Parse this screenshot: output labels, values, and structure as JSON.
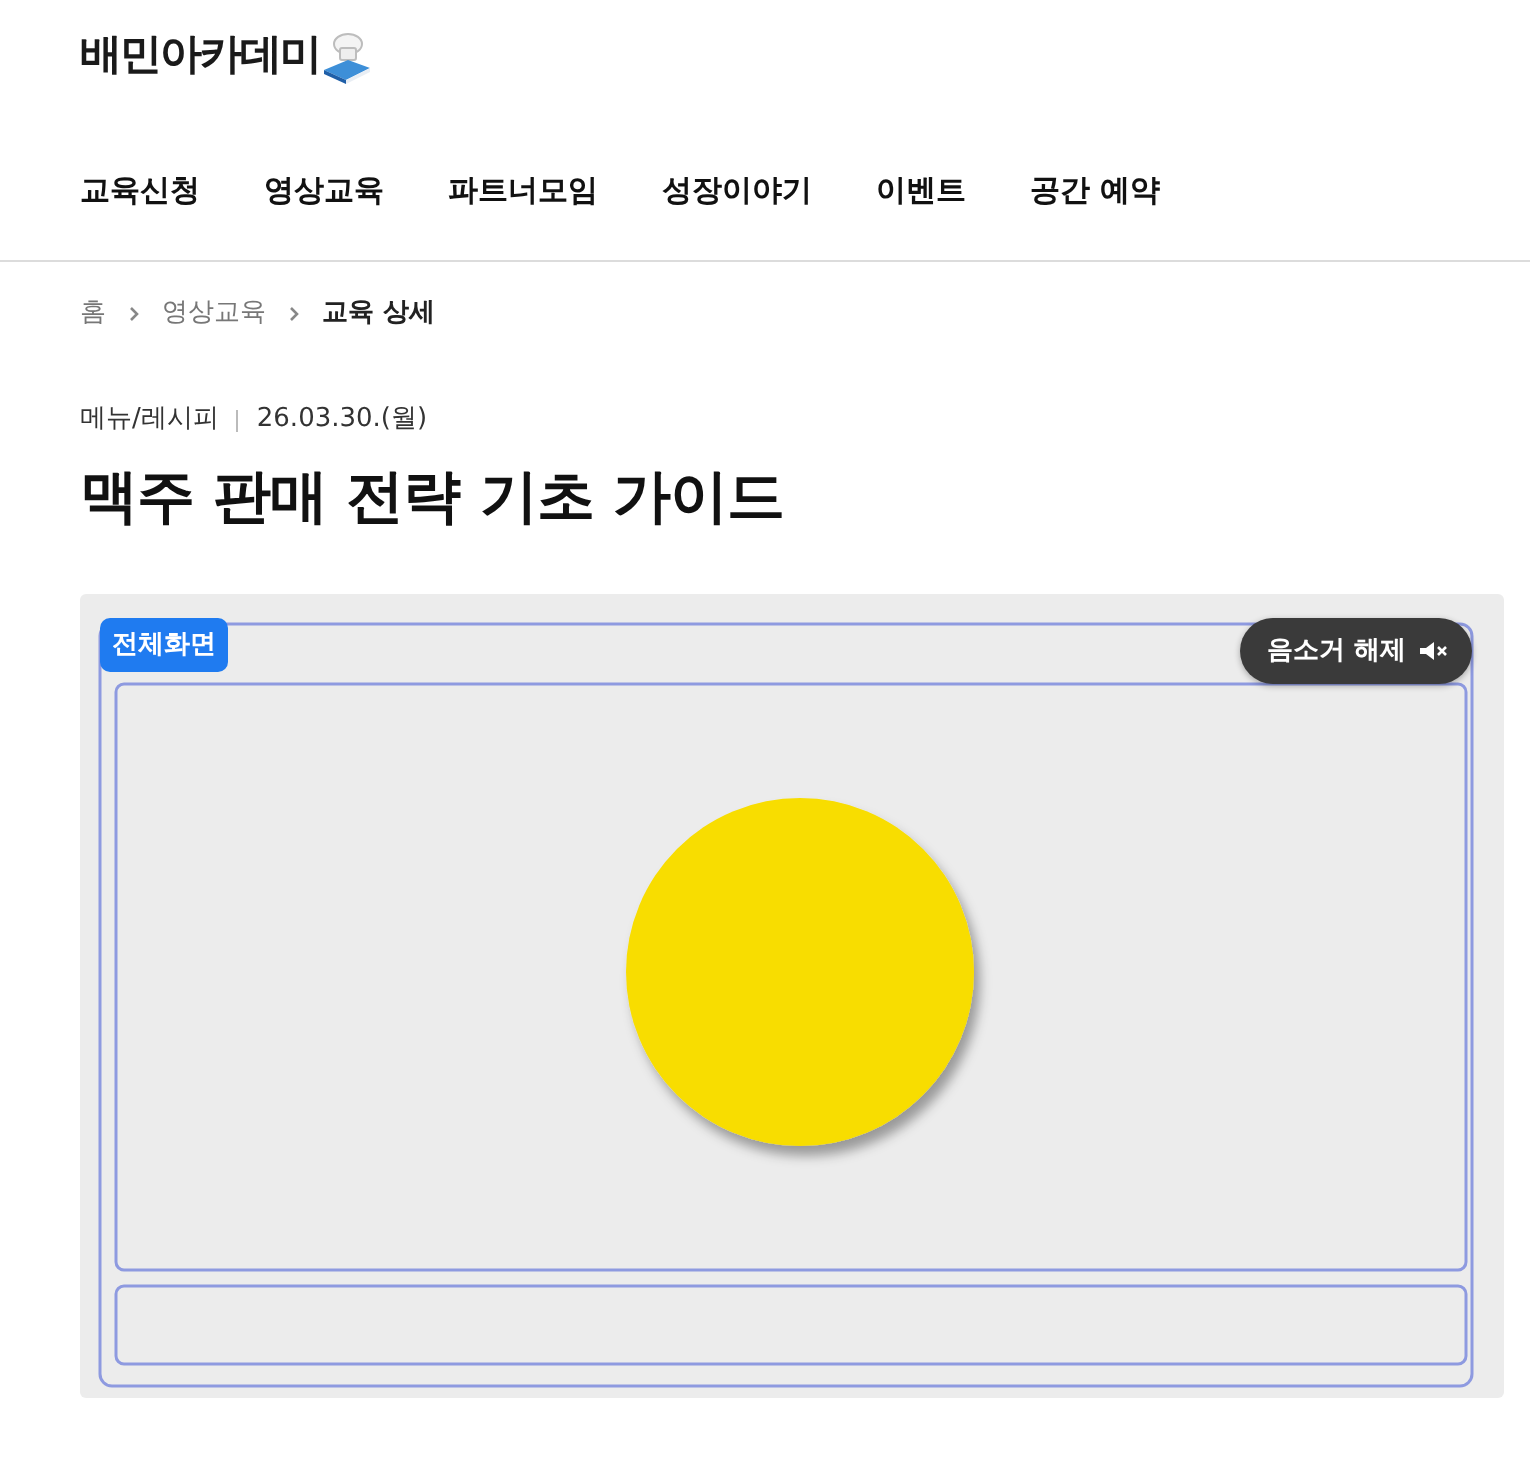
{
  "logo": {
    "text": "배민아카데미"
  },
  "nav": [
    {
      "label": "교육신청"
    },
    {
      "label": "영상교육"
    },
    {
      "label": "파트너모임"
    },
    {
      "label": "성장이야기"
    },
    {
      "label": "이벤트"
    },
    {
      "label": "공간 예약"
    }
  ],
  "breadcrumb": [
    {
      "label": "홈",
      "current": false
    },
    {
      "label": "영상교육",
      "current": false
    },
    {
      "label": "교육 상세",
      "current": true
    }
  ],
  "article": {
    "category": "메뉴/레시피",
    "date": "26.03.30.(월)",
    "title": "맥주 판매 전략 기초 가이드"
  },
  "video": {
    "fullscreen_button": "전체화면",
    "unmute_button": "음소거 해제",
    "muted": true
  }
}
